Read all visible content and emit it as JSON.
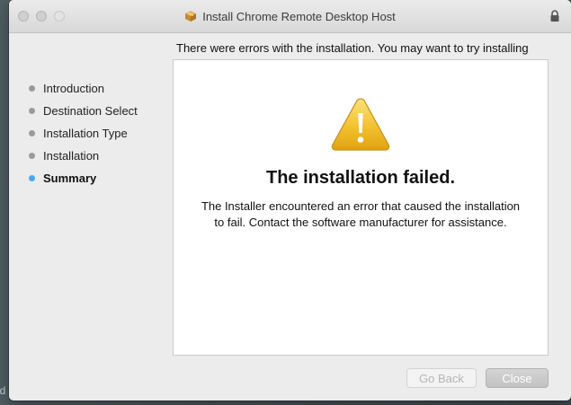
{
  "window": {
    "title": "Install Chrome Remote Desktop Host",
    "title_icon": "package-icon",
    "lock_icon": "lock-icon"
  },
  "header": {
    "message": "There were errors with the installation. You may want to try installing"
  },
  "sidebar": {
    "items": [
      {
        "label": "Introduction",
        "state": "done"
      },
      {
        "label": "Destination Select",
        "state": "done"
      },
      {
        "label": "Installation Type",
        "state": "done"
      },
      {
        "label": "Installation",
        "state": "done"
      },
      {
        "label": "Summary",
        "state": "current"
      }
    ],
    "active_color": "#4aa6f2",
    "inactive_color": "#9a9a9a"
  },
  "main": {
    "icon": "warning-icon",
    "heading": "The installation failed.",
    "body": "The Installer encountered an error that caused the installation to fail. Contact the software manufacturer for assistance."
  },
  "buttons": {
    "back_label": "Go Back",
    "back_enabled": false,
    "close_label": "Close"
  },
  "desktop": {
    "partial_text": "ld"
  }
}
